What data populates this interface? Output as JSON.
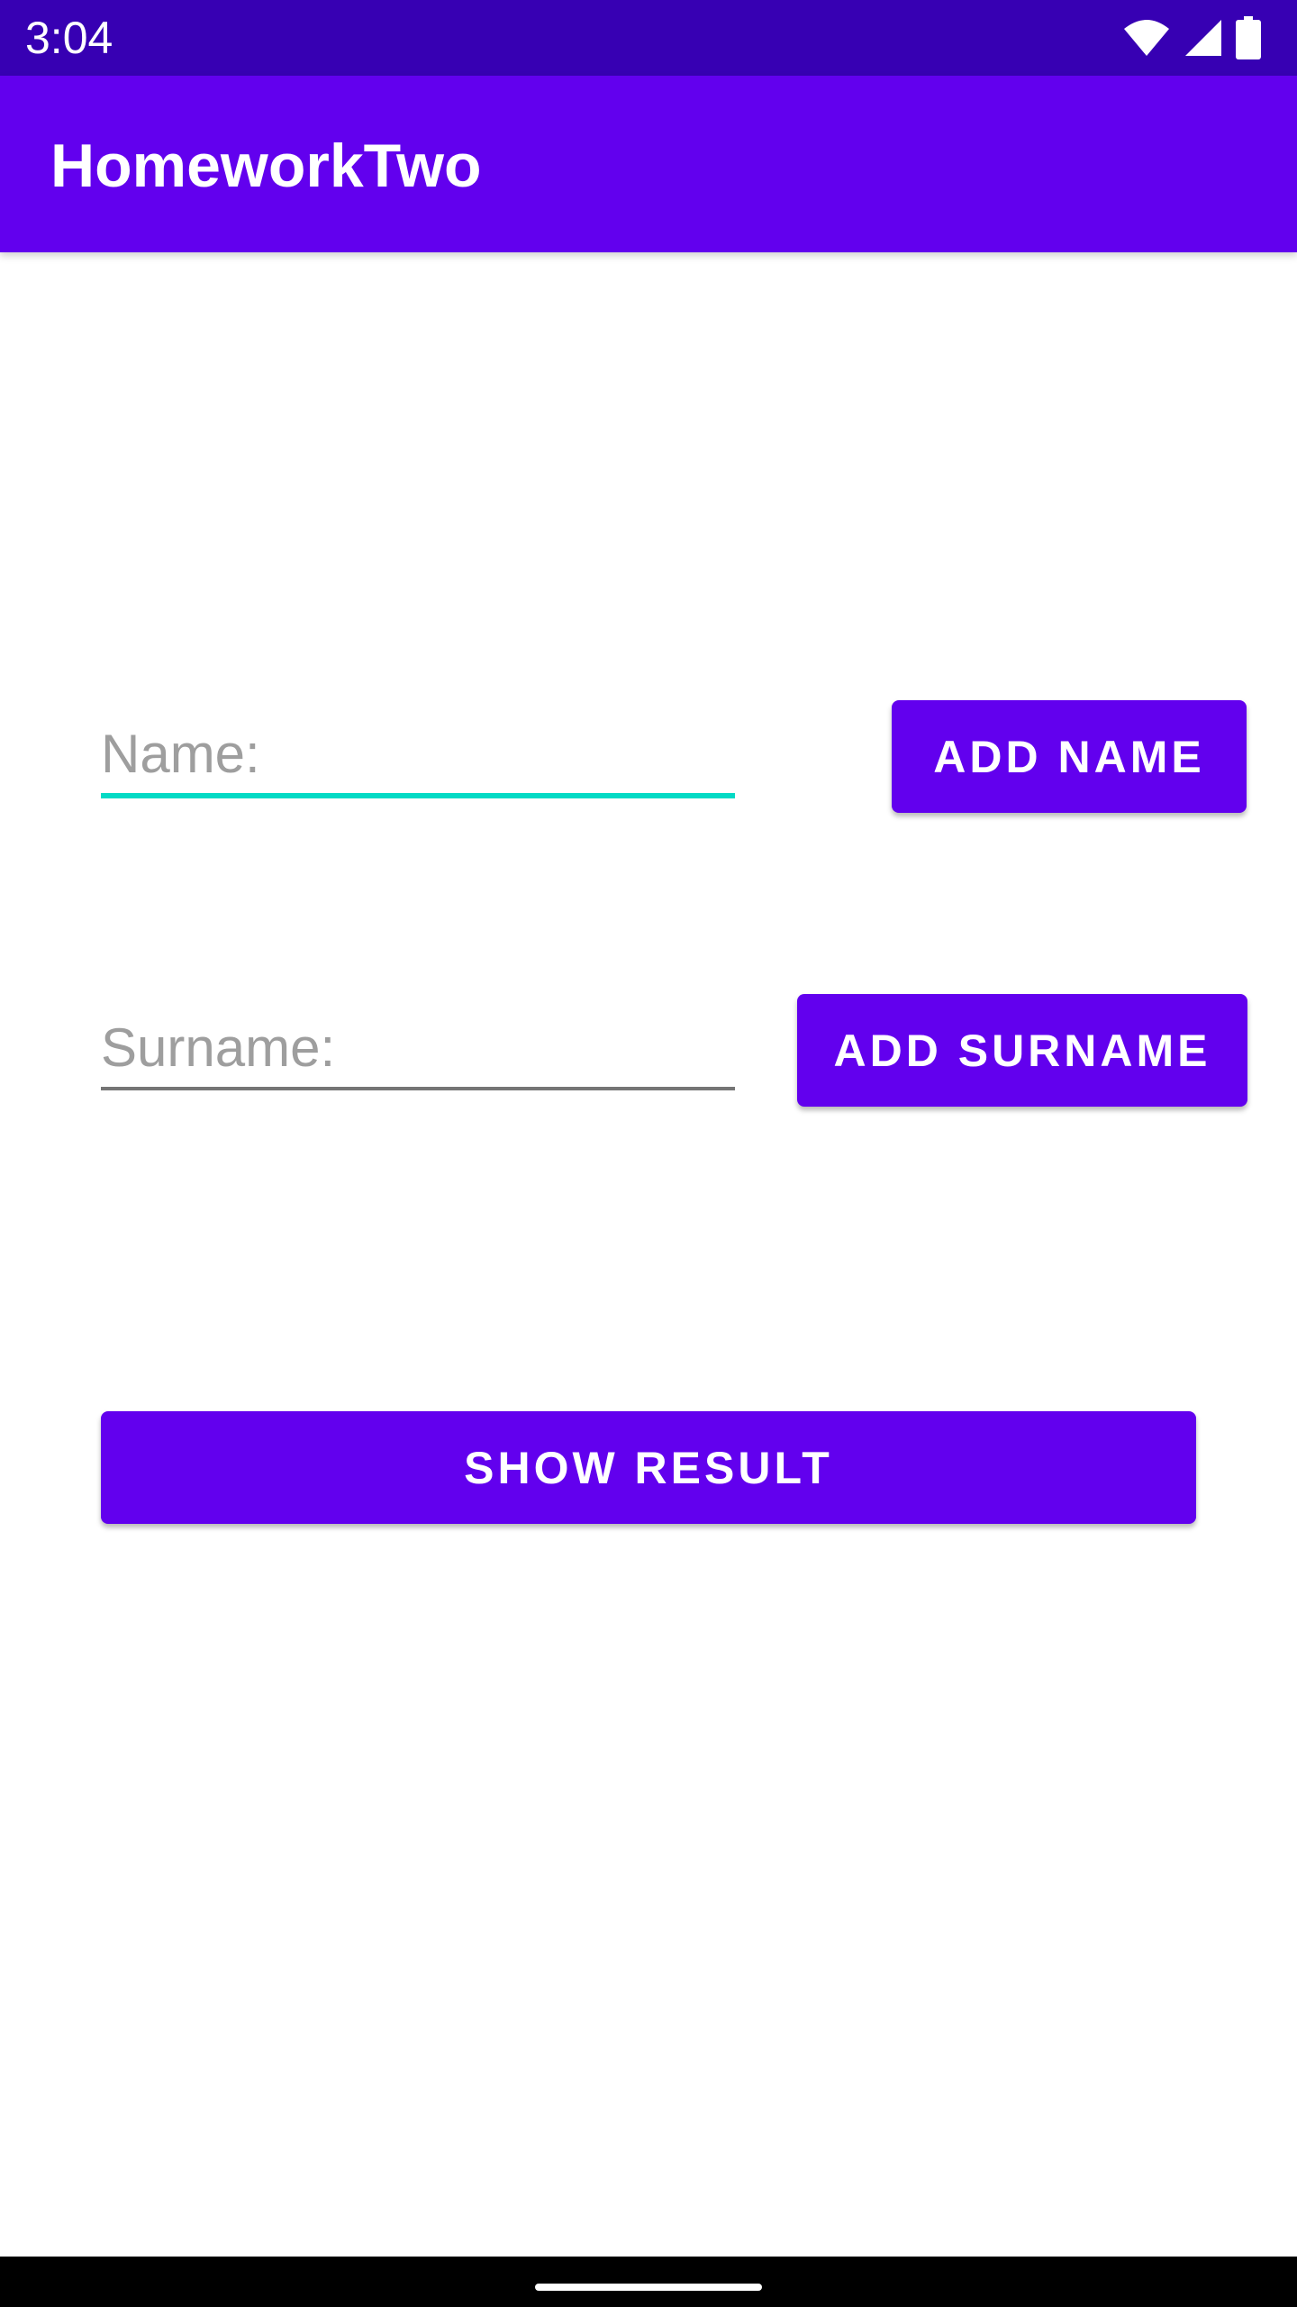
{
  "status_bar": {
    "time": "3:04",
    "icons": [
      "wifi-icon",
      "cellular-signal-icon",
      "battery-icon"
    ]
  },
  "app_bar": {
    "title": "HomeworkTwo"
  },
  "form": {
    "name_field": {
      "placeholder": "Name:",
      "value": ""
    },
    "surname_field": {
      "placeholder": "Surname:",
      "value": ""
    },
    "add_name_label": "ADD NAME",
    "add_surname_label": "ADD SURNAME",
    "show_result_label": "SHOW RESULT"
  },
  "colors": {
    "primary": "#6200ee",
    "primary_dark": "#3700b3",
    "accent": "#03dac5"
  }
}
